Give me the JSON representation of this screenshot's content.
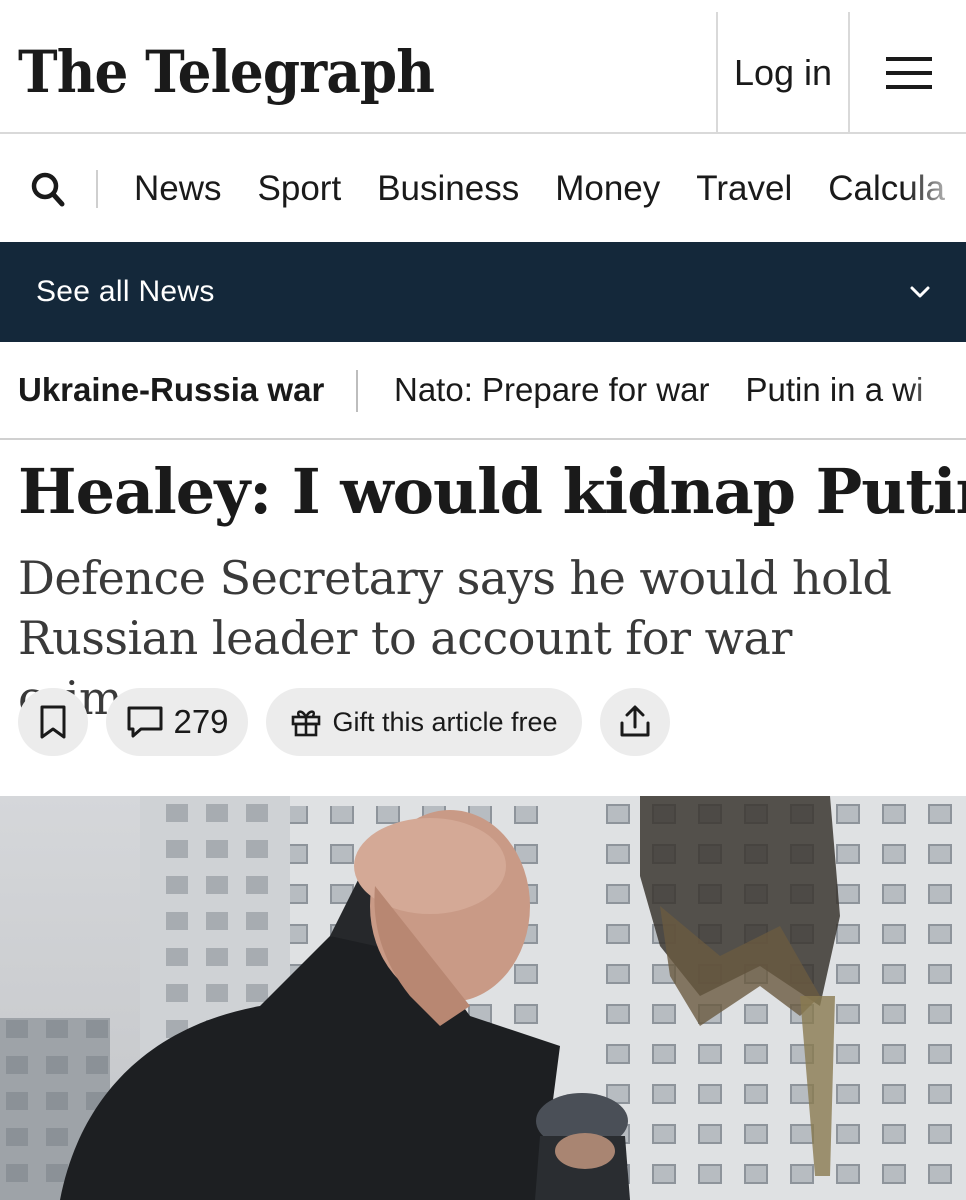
{
  "brand": {
    "logo_text": "The Telegraph"
  },
  "header": {
    "login_label": "Log in",
    "menu_icon": "hamburger-menu-icon"
  },
  "nav": {
    "search_icon": "search-icon",
    "items": [
      "News",
      "Sport",
      "Business",
      "Money",
      "Travel",
      "Calcula"
    ]
  },
  "section_bar": {
    "label": "See all News",
    "icon": "chevron-down-icon"
  },
  "topics": {
    "main": "Ukraine-Russia war",
    "links": [
      "Nato: Prepare for war",
      "Putin in a wi"
    ]
  },
  "article": {
    "headline": "Healey: I would kidnap Putin",
    "standfirst_lines": [
      "Defence Secretary says he would hold",
      "Russian leader to account for war crimes"
    ],
    "actions": {
      "bookmark_icon": "bookmark-icon",
      "comment_icon": "comment-icon",
      "comment_count": "279",
      "gift_icon": "gift-icon",
      "gift_label": "Gift this article free",
      "share_icon": "share-icon"
    }
  },
  "colors": {
    "section_bar_bg": "#14283a",
    "pill_bg": "#ececec"
  }
}
